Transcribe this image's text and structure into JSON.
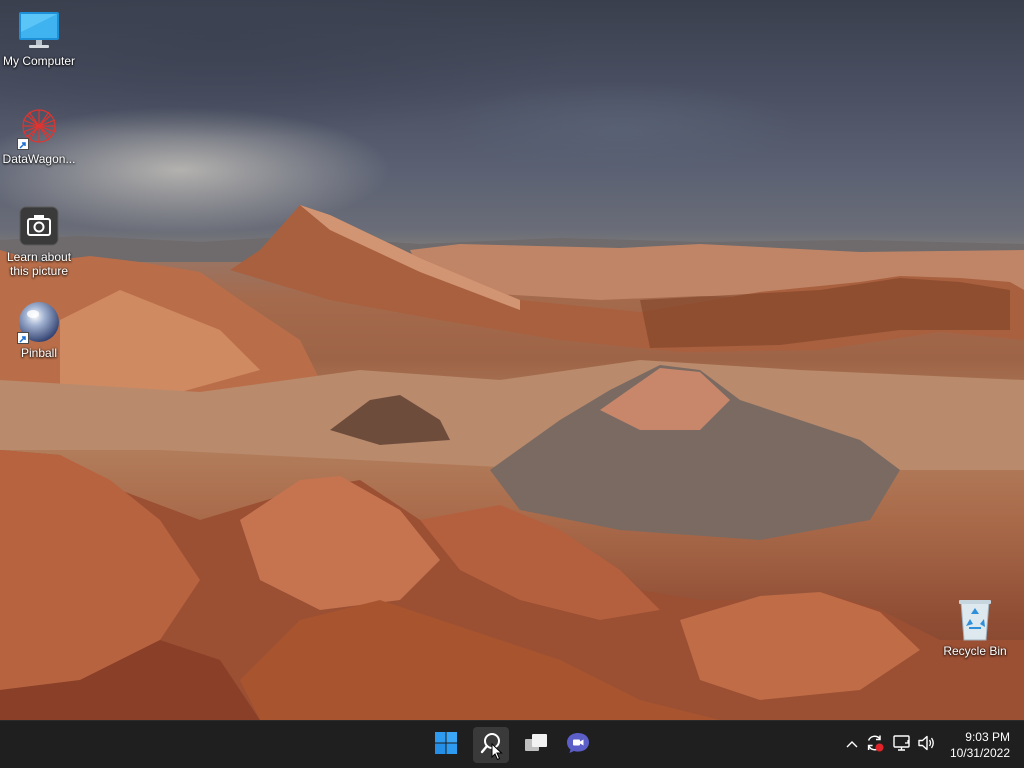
{
  "desktop": {
    "wallpaper": "desert-canyon-landscape",
    "icons": [
      {
        "label": "My Computer",
        "icon": "monitor-icon"
      },
      {
        "label": "DataWagon...",
        "icon": "datawagon-icon"
      },
      {
        "label": "Learn about this picture",
        "icon": "camera-icon"
      },
      {
        "label": "Pinball",
        "icon": "pinball-icon"
      },
      {
        "label": "Recycle Bin",
        "icon": "recycle-bin-icon"
      }
    ]
  },
  "taskbar": {
    "pinned": [
      {
        "name": "Start",
        "icon": "windows-start-icon"
      },
      {
        "name": "Search",
        "icon": "search-icon"
      },
      {
        "name": "Task View",
        "icon": "task-view-icon"
      },
      {
        "name": "Chat",
        "icon": "chat-icon"
      }
    ],
    "tray": {
      "icons": [
        "chevron-up-icon",
        "update-icon",
        "network-icon",
        "volume-icon"
      ]
    },
    "clock": {
      "time": "9:03 PM",
      "date": "10/31/2022"
    }
  },
  "colors": {
    "taskbar_bg": "#1f1f1f",
    "start_blue": "#2e9bf0",
    "chat_purple": "#5b5fc7",
    "update_badge_red": "#e0242a"
  }
}
